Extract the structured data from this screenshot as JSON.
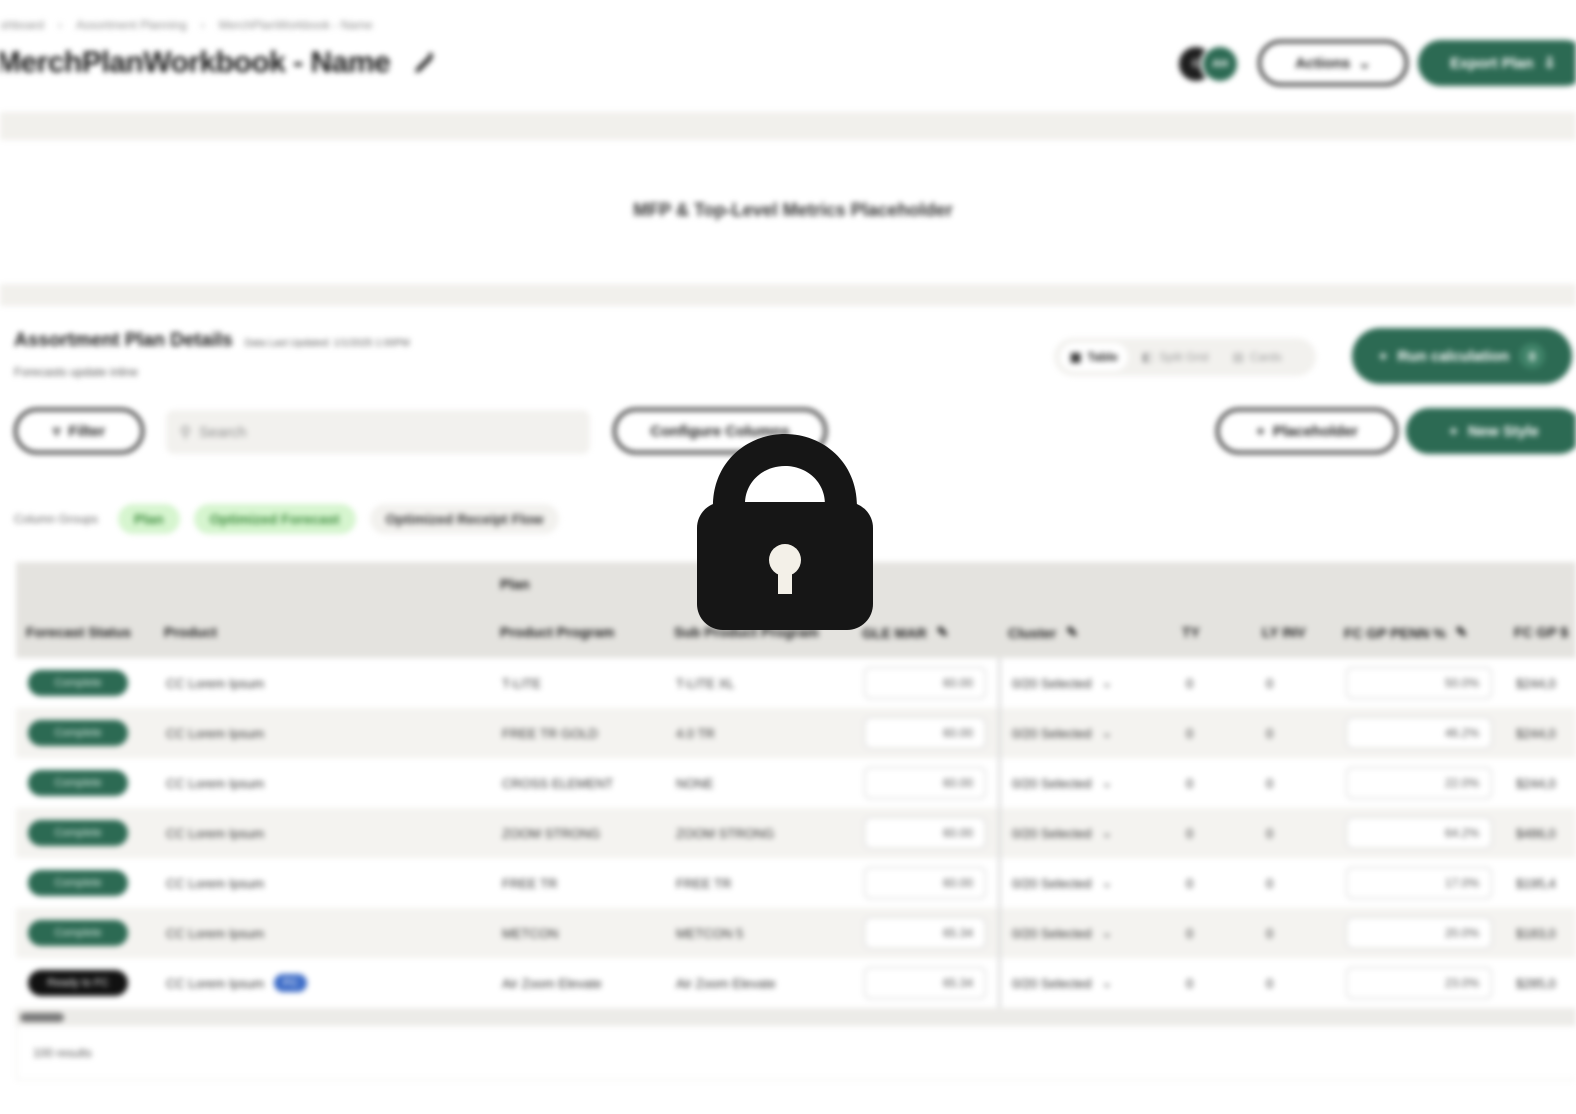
{
  "breadcrumb": [
    "ashboard",
    "Assortment Planning",
    "MerchPlanWorkbook - Name"
  ],
  "header": {
    "title": "MerchPlanWorkbook - Name",
    "avatars": [
      "C",
      "AH"
    ],
    "actions_label": "Actions",
    "export_label": "Export Plan"
  },
  "metrics": {
    "placeholder": "MFP & Top-Level Metrics Placeholder"
  },
  "section": {
    "title": "Assortment Plan Details",
    "last_updated": "Data Last Updated: 1/1/2025 1:00PM",
    "subtitle": "Forecasts update inline",
    "view_options": [
      "Table",
      "Split Grid",
      "Cards"
    ],
    "run_label": "Run calculation",
    "run_count": "0"
  },
  "toolbar": {
    "filter_label": "Filter",
    "search_placeholder": "Search",
    "configure_label": "Configure Columns",
    "placeholder_label": "Placeholder",
    "new_style_label": "New Style"
  },
  "column_groups": {
    "label": "Column Groups",
    "chips": [
      "Plan",
      "Optimized Forecast",
      "Optimized Receipt Flow"
    ]
  },
  "table": {
    "group_header": "Plan",
    "columns": [
      "Forecast Status",
      "Product",
      "Product Program",
      "Sub Product Program",
      "GLE MAR",
      "Cluster",
      "TY",
      "LY INV",
      "FC GP PENN %",
      "FC GP $"
    ],
    "rows": [
      {
        "status": "Complete",
        "product": "CC Lorem Ipsum",
        "program": "T-LITE",
        "sub": "T-LITE XL",
        "gle": "60.00",
        "cluster": "0/20 Selected",
        "ty": "0",
        "ly": "0",
        "fc": "50.0%",
        "fcd": "$244,0"
      },
      {
        "status": "Complete",
        "product": "CC Lorem Ipsum",
        "program": "FREE TR GOLD",
        "sub": "4.0 TR",
        "gle": "60.00",
        "cluster": "0/20 Selected",
        "ty": "0",
        "ly": "0",
        "fc": "46.2%",
        "fcd": "$244,0"
      },
      {
        "status": "Complete",
        "product": "CC Lorem Ipsum",
        "program": "CROSS ELEMENT",
        "sub": "NONE",
        "gle": "60.00",
        "cluster": "0/20 Selected",
        "ty": "0",
        "ly": "0",
        "fc": "22.0%",
        "fcd": "$244,0"
      },
      {
        "status": "Complete",
        "product": "CC Lorem Ipsum",
        "program": "ZOOM STRONG",
        "sub": "ZOOM STRONG",
        "gle": "60.00",
        "cluster": "0/20 Selected",
        "ty": "0",
        "ly": "0",
        "fc": "64.2%",
        "fcd": "$486,0"
      },
      {
        "status": "Complete",
        "product": "CC Lorem Ipsum",
        "program": "FREE TR",
        "sub": "FREE TR",
        "gle": "60.00",
        "cluster": "0/20 Selected",
        "ty": "0",
        "ly": "0",
        "fc": "17.0%",
        "fcd": "$195,4"
      },
      {
        "status": "Complete",
        "product": "CC Lorem Ipsum",
        "program": "METCON",
        "sub": "METCON 5",
        "gle": "65.34",
        "cluster": "0/20 Selected",
        "ty": "0",
        "ly": "0",
        "fc": "20.0%",
        "fcd": "$183,0"
      },
      {
        "status": "Ready to FC",
        "product": "CC Lorem Ipsum",
        "badge": "FC",
        "program": "Air Zoom Elevate",
        "sub": "Air Zoom Elevate",
        "gle": "65.34",
        "cluster": "0/20 Selected",
        "ty": "0",
        "ly": "0",
        "fc": "23.0%",
        "fcd": "$285,0"
      }
    ],
    "results": "100 results"
  },
  "colors": {
    "brand_green": "#2c6a53",
    "chip_green": "#d6f5cf",
    "band_gray": "#f1f0ec"
  },
  "overlay_icon": "lock-icon"
}
